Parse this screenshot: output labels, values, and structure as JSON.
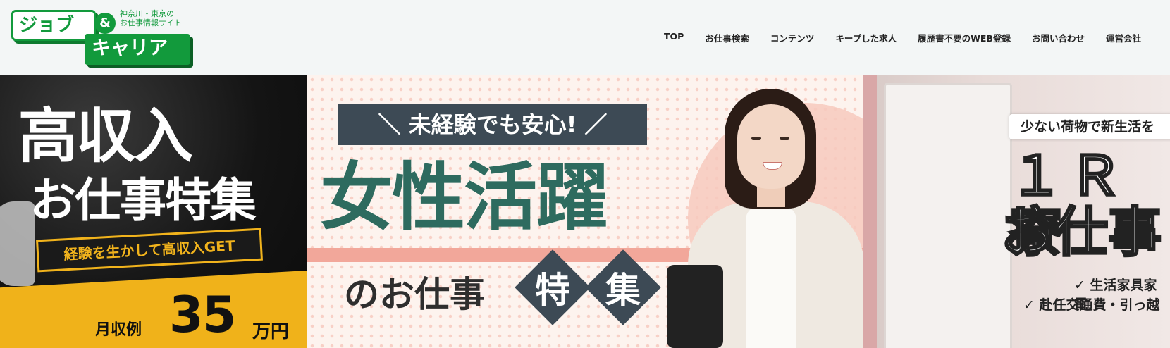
{
  "logo": {
    "top": "ジョブ",
    "amp": "&",
    "bottom": "キャリア",
    "tagline": "神奈川・東京の\nお仕事情報サイト"
  },
  "nav": [
    {
      "label": "TOP"
    },
    {
      "label": "お仕事検索"
    },
    {
      "label": "コンテンツ"
    },
    {
      "label": "キープした求人"
    },
    {
      "label": "履歴書不要のWEB登録"
    },
    {
      "label": "お問い合わせ"
    },
    {
      "label": "運営会社"
    }
  ],
  "slides": {
    "high_income": {
      "title_line1": "高収入",
      "title_line2": "お仕事特集",
      "badge": "経験を生かして高収入GET",
      "salary_prefix": "月収例",
      "salary_value": "35",
      "salary_unit": "万円"
    },
    "women": {
      "tag": "＼ 未経験でも安心! ／",
      "main": "女性活躍",
      "sub": "のお仕事",
      "diamond1": "特",
      "diamond2": "集"
    },
    "dorm": {
      "tag": "少ない荷物で新生活を",
      "main_line1": "１Ｒ寮",
      "main_line2": "お仕事",
      "check1": "✓ 生活家具家電",
      "check2": "✓ 赴任交通費・引っ越"
    }
  },
  "colors": {
    "brand_green": "#129a3c",
    "slide1_gold": "#f0b21a",
    "slide2_teal": "#2e6b5f",
    "slide2_slate": "#3d4a55"
  }
}
